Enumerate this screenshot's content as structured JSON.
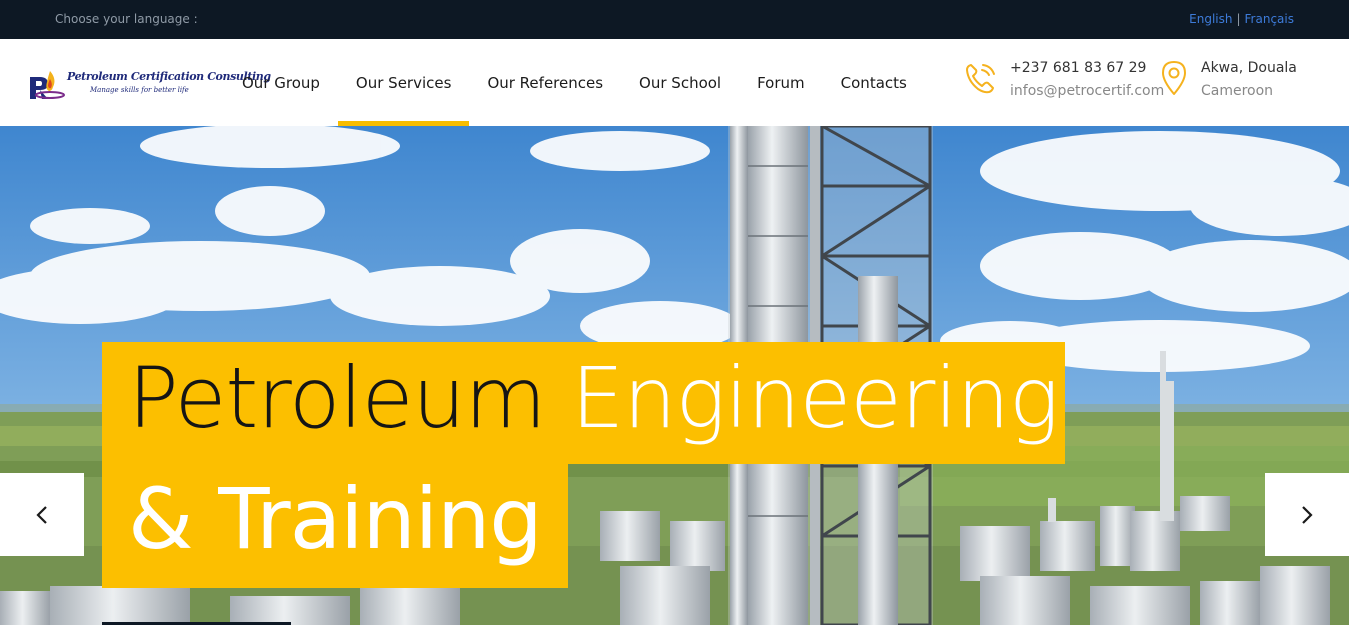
{
  "topbar": {
    "language_prompt": "Choose your language :",
    "languages": [
      "English",
      "Français"
    ],
    "separator": "|"
  },
  "brand": {
    "name": "Petroleum Certification Consulting",
    "tagline": "Manage skills for better life"
  },
  "nav": {
    "items": [
      "Our Group",
      "Our Services",
      "Our References",
      "Our School",
      "Forum",
      "Contacts"
    ],
    "active": "Our Services"
  },
  "contact": {
    "phone": "+237 681 83 67 29",
    "email": "infos@petrocertif.com",
    "city": "Akwa, Douala",
    "country": "Cameroon"
  },
  "hero": {
    "caption_word1": "Petroleum",
    "caption_word2": "Engineering",
    "caption_line2": "& Training"
  },
  "colors": {
    "accent": "#fcbf00",
    "topbar_bg": "#0d1824",
    "link": "#3d7bd9"
  },
  "icons": {
    "phone": "phone-icon",
    "location": "map-pin-icon",
    "prev": "chevron-left-icon",
    "next": "chevron-right-icon"
  }
}
